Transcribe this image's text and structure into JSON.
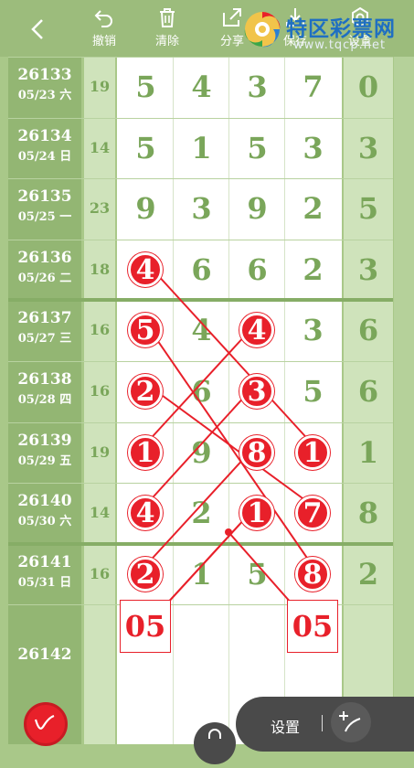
{
  "toolbar": {
    "undo_label": "撤销",
    "clear_label": "清除",
    "share_label": "分享",
    "save_label": "保存",
    "settings_label": "设置"
  },
  "logo": {
    "name": "特区彩票网",
    "url": "www.tqcp.net"
  },
  "rows": [
    {
      "issue": "26133",
      "date": "05/23 六",
      "sum": "19",
      "digits": [
        "5",
        "4",
        "3",
        "7"
      ],
      "right": "0"
    },
    {
      "issue": "26134",
      "date": "05/24 日",
      "sum": "14",
      "digits": [
        "5",
        "1",
        "5",
        "3"
      ],
      "right": "3"
    },
    {
      "issue": "26135",
      "date": "05/25 一",
      "sum": "23",
      "digits": [
        "9",
        "3",
        "9",
        "2"
      ],
      "right": "5"
    },
    {
      "issue": "26136",
      "date": "05/26 二",
      "sum": "18",
      "digits": [
        "4",
        "6",
        "6",
        "2"
      ],
      "right": "3"
    },
    {
      "issue": "26137",
      "date": "05/27 三",
      "sum": "16",
      "digits": [
        "5",
        "4",
        "4",
        "3"
      ],
      "right": "6"
    },
    {
      "issue": "26138",
      "date": "05/28 四",
      "sum": "16",
      "digits": [
        "2",
        "6",
        "3",
        "5"
      ],
      "right": "6"
    },
    {
      "issue": "26139",
      "date": "05/29 五",
      "sum": "19",
      "digits": [
        "1",
        "9",
        "8",
        "1"
      ],
      "right": "1"
    },
    {
      "issue": "26140",
      "date": "05/30 六",
      "sum": "14",
      "digits": [
        "4",
        "2",
        "1",
        "7"
      ],
      "right": "8"
    },
    {
      "issue": "26141",
      "date": "05/31 日",
      "sum": "16",
      "digits": [
        "2",
        "1",
        "5",
        "8"
      ],
      "right": "2"
    },
    {
      "issue": "26142",
      "date": "",
      "sum": "",
      "digits": [
        "",
        "",
        "",
        ""
      ],
      "right": ""
    }
  ],
  "predictions": [
    "05",
    "05"
  ],
  "bottom": {
    "settings_label": "设置"
  },
  "colors": {
    "accent": "#e8202a",
    "grid_green": "#7aa65a",
    "issue_bg": "#93b673",
    "topbar": "#9cbc7c"
  }
}
